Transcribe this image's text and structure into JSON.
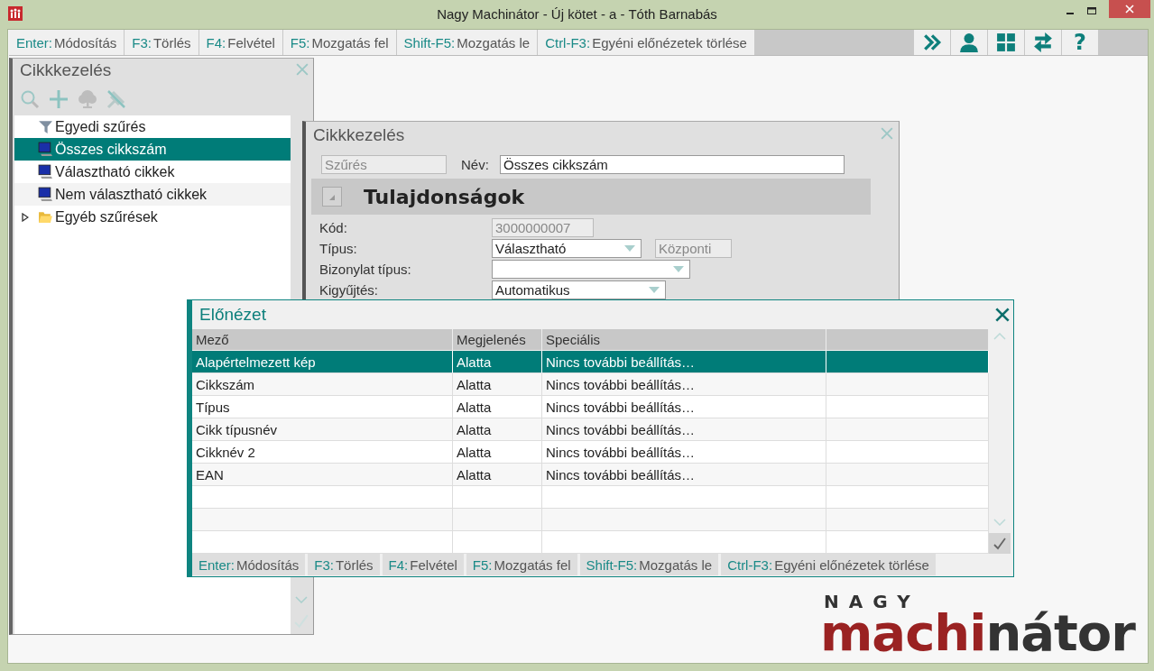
{
  "window": {
    "title": "Nagy Machinátor - Új kötet - a - Tóth Barnabás"
  },
  "toolbar": {
    "shortcuts": [
      {
        "key": "Enter:",
        "label": "Módosítás"
      },
      {
        "key": "F3:",
        "label": "Törlés"
      },
      {
        "key": "F4:",
        "label": "Felvétel"
      },
      {
        "key": "F5:",
        "label": "Mozgatás fel"
      },
      {
        "key": "Shift-F5:",
        "label": "Mozgatás le"
      },
      {
        "key": "Ctrl-F3:",
        "label": "Egyéni előnézetek törlése"
      }
    ],
    "help_label": "?"
  },
  "left_panel": {
    "title": "Cikkkezelés",
    "items": [
      {
        "label": "Egyedi szűrés",
        "kind": "filter",
        "selected": false,
        "hovered": false
      },
      {
        "label": "Összes cikkszám",
        "kind": "monitor",
        "selected": true,
        "hovered": false
      },
      {
        "label": "Választható cikkek",
        "kind": "monitor",
        "selected": false,
        "hovered": false
      },
      {
        "label": "Nem választható cikkek",
        "kind": "monitor",
        "selected": false,
        "hovered": true
      },
      {
        "label": "Egyéb szűrések",
        "kind": "folder",
        "selected": false,
        "hovered": false,
        "expanded": false
      }
    ]
  },
  "details_dialog": {
    "title": "Cikkkezelés",
    "filter_value": "Szűrés",
    "name_label": "Név:",
    "name_value": "Összes cikkszám",
    "section_title": "Tulajdonságok",
    "fields": [
      {
        "label": "Kód:",
        "kind": "readonly",
        "value": "3000000007"
      },
      {
        "label": "Típus:",
        "kind": "dropdown",
        "value": "Választható",
        "extra": "Központi"
      },
      {
        "label": "Bizonylat típus:",
        "kind": "dropdown"
      },
      {
        "label": "Kigyűjtés:",
        "kind": "dropdown",
        "value": "Automatikus"
      }
    ]
  },
  "preview_dialog": {
    "title": "Előnézet",
    "columns": [
      "Mező",
      "Megjelenés",
      "Speciális"
    ],
    "rows": [
      {
        "field": "Alapértelmezett kép",
        "display": "Alatta",
        "special": "Nincs további beállítás…",
        "selected": true
      },
      {
        "field": "Cikkszám",
        "display": "Alatta",
        "special": "Nincs további beállítás…",
        "selected": false
      },
      {
        "field": "Típus",
        "display": "Alatta",
        "special": "Nincs további beállítás…",
        "selected": false
      },
      {
        "field": "Cikk típusnév",
        "display": "Alatta",
        "special": "Nincs további beállítás…",
        "selected": false
      },
      {
        "field": "Cikknév 2",
        "display": "Alatta",
        "special": "Nincs további beállítás…",
        "selected": false
      },
      {
        "field": "EAN",
        "display": "Alatta",
        "special": "Nincs további beállítás…",
        "selected": false
      }
    ],
    "shortcuts": [
      {
        "key": "Enter:",
        "label": "Módosítás"
      },
      {
        "key": "F3:",
        "label": "Törlés"
      },
      {
        "key": "F4:",
        "label": "Felvétel"
      },
      {
        "key": "F5:",
        "label": "Mozgatás fel"
      },
      {
        "key": "Shift-F5:",
        "label": "Mozgatás le"
      },
      {
        "key": "Ctrl-F3:",
        "label": "Egyéni előnézetek törlése"
      }
    ]
  },
  "logo": {
    "top": "NAGY",
    "red": "machi",
    "dark": "nátor"
  }
}
